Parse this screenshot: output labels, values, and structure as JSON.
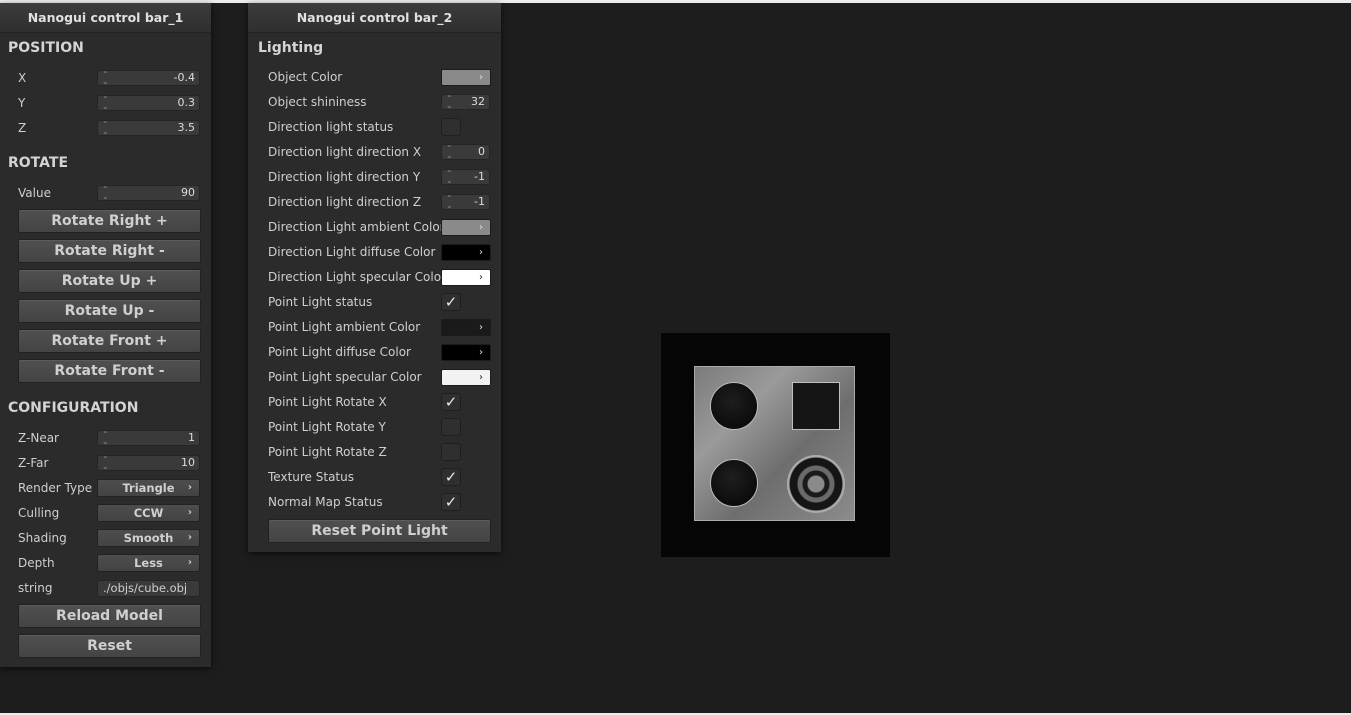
{
  "panel1": {
    "title": "Nanogui control bar_1",
    "position": {
      "heading": "POSITION",
      "x_label": "X",
      "x_value": "-0.4",
      "y_label": "Y",
      "y_value": "0.3",
      "z_label": "Z",
      "z_value": "3.5"
    },
    "rotate": {
      "heading": "ROTATE",
      "value_label": "Value",
      "value": "90",
      "buttons": [
        "Rotate Right +",
        "Rotate Right -",
        "Rotate Up +",
        "Rotate Up -",
        "Rotate Front +",
        "Rotate Front -"
      ]
    },
    "configuration": {
      "heading": "CONFIGURATION",
      "znear_label": "Z-Near",
      "znear_value": "1",
      "zfar_label": "Z-Far",
      "zfar_value": "10",
      "render_type_label": "Render Type",
      "render_type_value": "Triangle",
      "culling_label": "Culling",
      "culling_value": "CCW",
      "shading_label": "Shading",
      "shading_value": "Smooth",
      "depth_label": "Depth",
      "depth_value": "Less",
      "string_label": "string",
      "string_value": "./objs/cube.obj",
      "reload_button": "Reload Model",
      "reset_button": "Reset"
    }
  },
  "panel2": {
    "title": "Nanogui control bar_2",
    "heading": "Lighting",
    "rows": [
      {
        "label": "Object Color",
        "kind": "color",
        "color": "#8a8a8a"
      },
      {
        "label": "Object shininess",
        "kind": "number",
        "value": "32"
      },
      {
        "label": "Direction light status",
        "kind": "check",
        "checked": false
      },
      {
        "label": "Direction light direction X",
        "kind": "number",
        "value": "0"
      },
      {
        "label": "Direction light direction Y",
        "kind": "number",
        "value": "-1"
      },
      {
        "label": "Direction light direction Z",
        "kind": "number",
        "value": "-1"
      },
      {
        "label": "Direction Light ambient Color",
        "kind": "color",
        "color": "#8a8a8a"
      },
      {
        "label": "Direction Light diffuse Color",
        "kind": "color",
        "color": "#000000"
      },
      {
        "label": "Direction Light specular Color",
        "kind": "color",
        "color": "#ffffff"
      },
      {
        "label": "Point Light status",
        "kind": "check",
        "checked": true
      },
      {
        "label": "Point Light ambient Color",
        "kind": "color",
        "color": "#1a1a1a"
      },
      {
        "label": "Point Light diffuse Color",
        "kind": "color",
        "color": "#000000"
      },
      {
        "label": "Point Light specular Color",
        "kind": "color",
        "color": "#f2f2f2"
      },
      {
        "label": "Point Light Rotate X",
        "kind": "check",
        "checked": true
      },
      {
        "label": "Point Light Rotate Y",
        "kind": "check",
        "checked": false
      },
      {
        "label": "Point Light Rotate Z",
        "kind": "check",
        "checked": false
      },
      {
        "label": "Texture Status",
        "kind": "check",
        "checked": true
      },
      {
        "label": "Normal Map Status",
        "kind": "check",
        "checked": true
      }
    ],
    "reset_button": "Reset Point Light",
    "arrow_glyph": "›",
    "check_glyph": "✓"
  },
  "colors": {
    "background": "#1d1d1d",
    "panel": "#2b2b2b",
    "button": "#4a4a4a"
  }
}
